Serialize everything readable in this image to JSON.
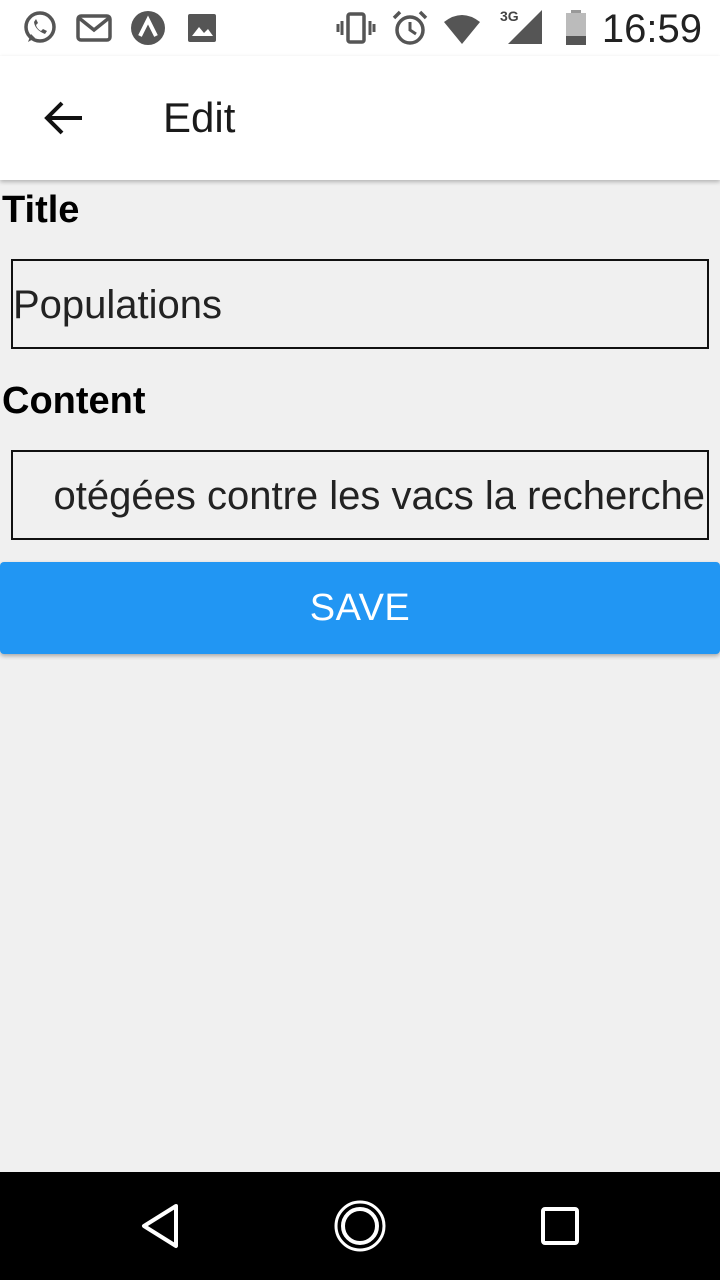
{
  "status_bar": {
    "time": "16:59",
    "network": "3G",
    "icons": [
      "whatsapp-icon",
      "gmail-icon",
      "app-icon",
      "image-icon",
      "vibrate-icon",
      "alarm-icon",
      "wifi-icon",
      "signal-icon",
      "battery-icon"
    ]
  },
  "app_bar": {
    "title": "Edit",
    "back_icon": "arrow-left-icon"
  },
  "form": {
    "title_label": "Title",
    "title_value": "Populations",
    "content_label": "Content",
    "content_value": "otégées contre les vacs la recherche"
  },
  "save_button": {
    "label": "SAVE",
    "color": "#2196f3"
  },
  "nav_bar": {
    "icons": [
      "back-triangle-icon",
      "home-circle-icon",
      "recents-square-icon"
    ]
  }
}
